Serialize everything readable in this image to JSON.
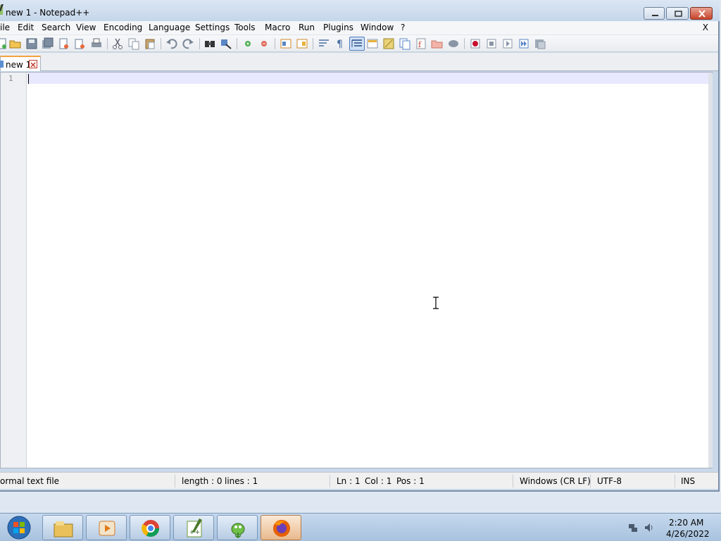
{
  "window": {
    "title": "new 1 - Notepad++"
  },
  "menu": {
    "items": [
      "ile",
      "Edit",
      "Search",
      "View",
      "Encoding",
      "Language",
      "Settings",
      "Tools",
      "Macro",
      "Run",
      "Plugins",
      "Window",
      "?"
    ],
    "close_label": "X"
  },
  "tab": {
    "label": "new 1"
  },
  "editor": {
    "line_number": "1",
    "current_line_color": "#e8e8ff"
  },
  "status": {
    "file_type": "ormal text file",
    "length": "length : 0",
    "lines": "lines : 1",
    "ln": "Ln : 1",
    "col": "Col : 1",
    "pos": "Pos : 1",
    "eol": "Windows (CR LF)",
    "encoding": "UTF-8",
    "mode": "INS"
  },
  "taskbar": {
    "apps": [
      "file-explorer-icon",
      "media-player-icon",
      "chrome-icon",
      "notepadpp-icon",
      "bird-app-icon",
      "firefox-icon"
    ],
    "active_app": "firefox-icon",
    "time": "2:20 AM",
    "date": "4/26/2022"
  },
  "colors": {
    "tab_accent": "#f4a341",
    "taskbar": "#b6cbe3",
    "close_button": "#c7442a"
  }
}
